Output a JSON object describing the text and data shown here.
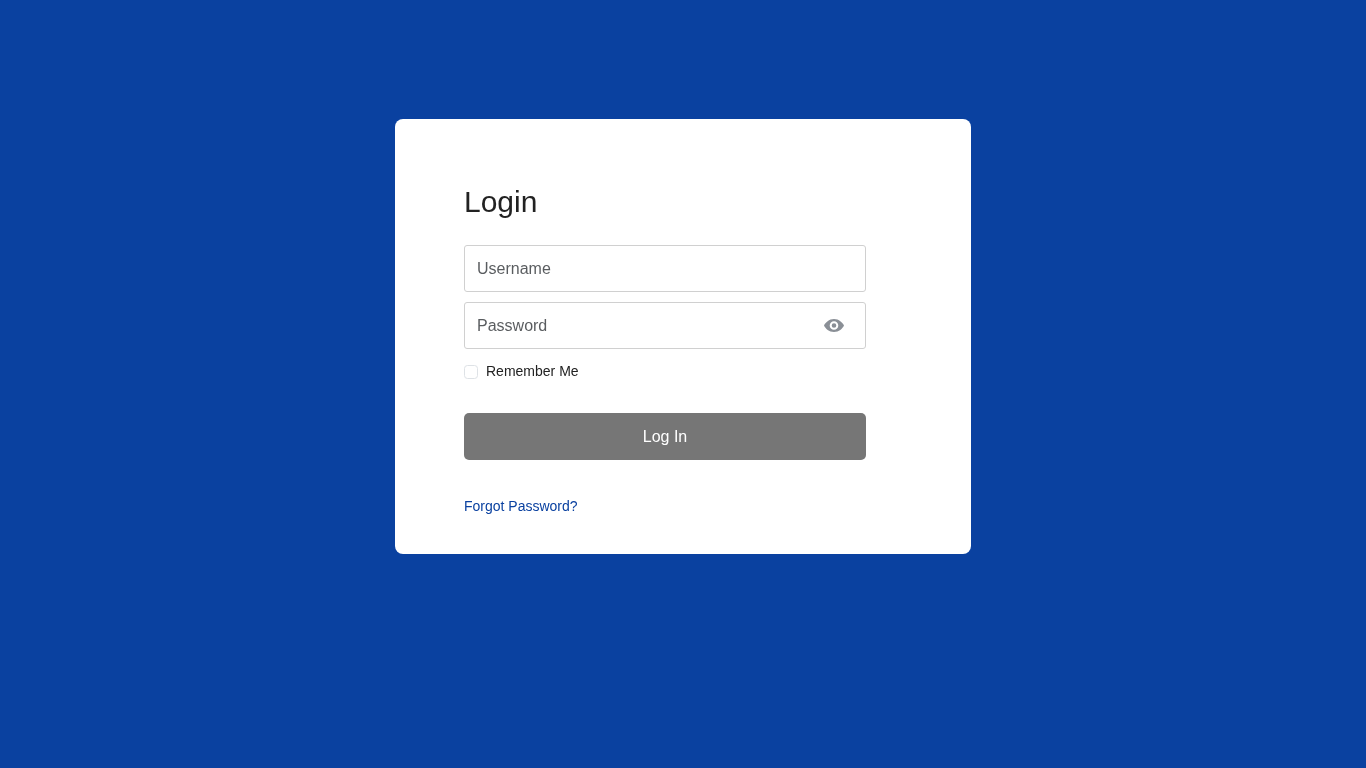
{
  "login_card": {
    "title": "Login",
    "username_field": {
      "placeholder": "Username"
    },
    "password_field": {
      "placeholder": "Password"
    },
    "remember_me": {
      "label": "Remember Me",
      "checked": false
    },
    "login_button": {
      "label": "Log In",
      "disabled": true
    },
    "forgot_password_link": "Forgot Password?"
  }
}
